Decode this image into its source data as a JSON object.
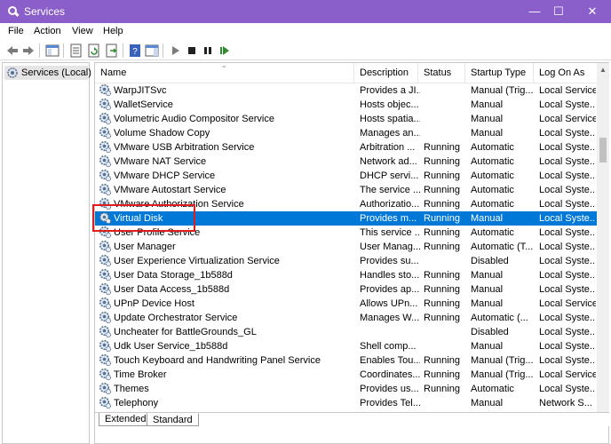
{
  "window": {
    "title": "Services",
    "minimize": "—",
    "maximize": "☐",
    "close": "✕",
    "accent": "#8b5fc9"
  },
  "menu": [
    "File",
    "Action",
    "View",
    "Help"
  ],
  "tree": {
    "root_label": "Services (Local)"
  },
  "columns": {
    "name": "Name",
    "description": "Description",
    "status": "Status",
    "startup_type": "Startup Type",
    "log_on_as": "Log On As"
  },
  "rows": [
    {
      "name": "WarpJITSvc",
      "description": "Provides a JI...",
      "status": "",
      "startup": "Manual (Trig...",
      "logon": "Local Service"
    },
    {
      "name": "WalletService",
      "description": "Hosts objec...",
      "status": "",
      "startup": "Manual",
      "logon": "Local Syste..."
    },
    {
      "name": "Volumetric Audio Compositor Service",
      "description": "Hosts spatia...",
      "status": "",
      "startup": "Manual",
      "logon": "Local Service"
    },
    {
      "name": "Volume Shadow Copy",
      "description": "Manages an...",
      "status": "",
      "startup": "Manual",
      "logon": "Local Syste..."
    },
    {
      "name": "VMware USB Arbitration Service",
      "description": "Arbitration ...",
      "status": "Running",
      "startup": "Automatic",
      "logon": "Local Syste..."
    },
    {
      "name": "VMware NAT Service",
      "description": "Network ad...",
      "status": "Running",
      "startup": "Automatic",
      "logon": "Local Syste..."
    },
    {
      "name": "VMware DHCP Service",
      "description": "DHCP servi...",
      "status": "Running",
      "startup": "Automatic",
      "logon": "Local Syste..."
    },
    {
      "name": "VMware Autostart Service",
      "description": "The service ...",
      "status": "Running",
      "startup": "Automatic",
      "logon": "Local Syste..."
    },
    {
      "name": "VMware Authorization Service",
      "description": "Authorizatio...",
      "status": "Running",
      "startup": "Automatic",
      "logon": "Local Syste..."
    },
    {
      "name": "Virtual Disk",
      "description": "Provides m...",
      "status": "Running",
      "startup": "Manual",
      "logon": "Local Syste...",
      "selected": true
    },
    {
      "name": "User Profile Service",
      "description": "This service ...",
      "status": "Running",
      "startup": "Automatic",
      "logon": "Local Syste..."
    },
    {
      "name": "User Manager",
      "description": "User Manag...",
      "status": "Running",
      "startup": "Automatic (T...",
      "logon": "Local Syste..."
    },
    {
      "name": "User Experience Virtualization Service",
      "description": "Provides su...",
      "status": "",
      "startup": "Disabled",
      "logon": "Local Syste..."
    },
    {
      "name": "User Data Storage_1b588d",
      "description": "Handles sto...",
      "status": "Running",
      "startup": "Manual",
      "logon": "Local Syste..."
    },
    {
      "name": "User Data Access_1b588d",
      "description": "Provides ap...",
      "status": "Running",
      "startup": "Manual",
      "logon": "Local Syste..."
    },
    {
      "name": "UPnP Device Host",
      "description": "Allows UPn...",
      "status": "Running",
      "startup": "Manual",
      "logon": "Local Service"
    },
    {
      "name": "Update Orchestrator Service",
      "description": "Manages W...",
      "status": "Running",
      "startup": "Automatic (...",
      "logon": "Local Syste..."
    },
    {
      "name": "Uncheater for BattleGrounds_GL",
      "description": "",
      "status": "",
      "startup": "Disabled",
      "logon": "Local Syste..."
    },
    {
      "name": "Udk User Service_1b588d",
      "description": "Shell comp...",
      "status": "",
      "startup": "Manual",
      "logon": "Local Syste..."
    },
    {
      "name": "Touch Keyboard and Handwriting Panel Service",
      "description": "Enables Tou...",
      "status": "Running",
      "startup": "Manual (Trig...",
      "logon": "Local Syste..."
    },
    {
      "name": "Time Broker",
      "description": "Coordinates...",
      "status": "Running",
      "startup": "Manual (Trig...",
      "logon": "Local Service"
    },
    {
      "name": "Themes",
      "description": "Provides us...",
      "status": "Running",
      "startup": "Automatic",
      "logon": "Local Syste..."
    },
    {
      "name": "Telephony",
      "description": "Provides Tel...",
      "status": "",
      "startup": "Manual",
      "logon": "Network S..."
    }
  ],
  "tabs": [
    "Extended",
    "Standard"
  ],
  "active_tab": "Standard",
  "selection_color": "#0078d7",
  "highlight_color": "#e01c1c"
}
